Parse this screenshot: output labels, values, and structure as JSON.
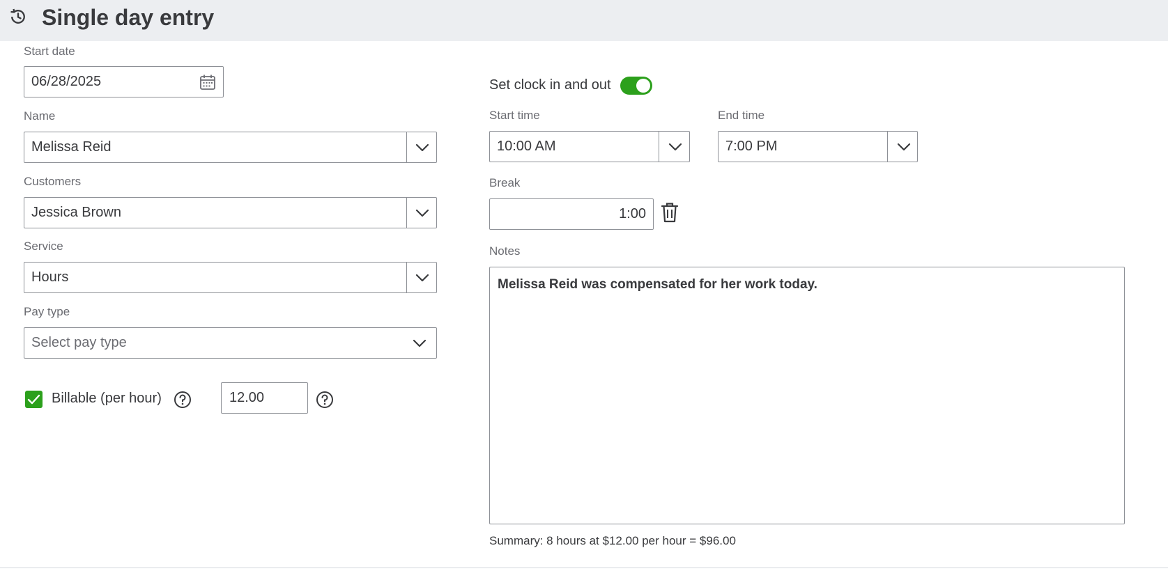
{
  "header": {
    "title": "Single day entry",
    "icon": "history-icon"
  },
  "form": {
    "start_date": {
      "label": "Start date",
      "value": "06/28/2025",
      "icon": "calendar-icon"
    },
    "name": {
      "label": "Name",
      "value": "Melissa Reid"
    },
    "customers": {
      "label": "Customers",
      "value": "Jessica Brown"
    },
    "service": {
      "label": "Service",
      "value": "Hours"
    },
    "pay_type": {
      "label": "Pay type",
      "placeholder": "Select pay type"
    },
    "billable": {
      "label": "Billable (per hour)",
      "checked": true,
      "rate": "12.00"
    }
  },
  "clock": {
    "toggle_label": "Set clock in and out",
    "toggle_on": true,
    "start_time": {
      "label": "Start time",
      "value": "10:00 AM"
    },
    "end_time": {
      "label": "End time",
      "value": "7:00 PM"
    },
    "break": {
      "label": "Break",
      "value": "1:00"
    }
  },
  "notes": {
    "label": "Notes",
    "value": "Melissa Reid was compensated for her work today."
  },
  "summary": "Summary: 8 hours at $12.00 per hour = $96.00",
  "colors": {
    "accent": "#2ca01c",
    "header_bg": "#eceef1",
    "text": "#393a3d",
    "border": "#8d9096"
  }
}
